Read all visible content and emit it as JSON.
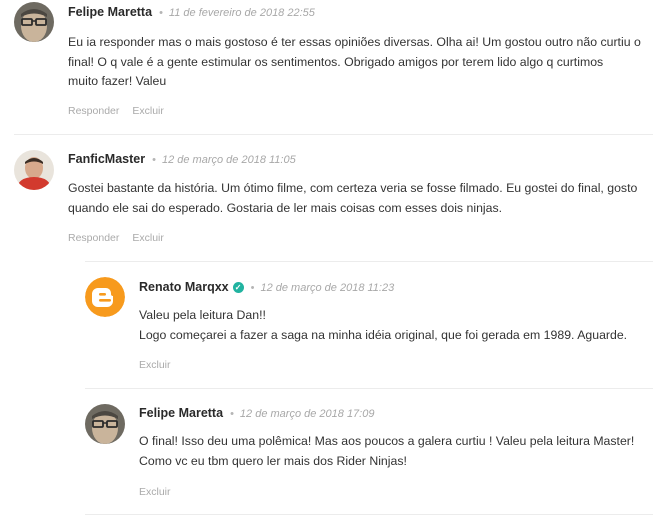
{
  "comments": [
    {
      "author": "Felipe Maretta",
      "date": "11 de fevereiro de 2018 22:55",
      "lines": [
        "Eu ia responder mas o mais gostoso é ter essas opiniões diversas. Olha ai! Um gostou outro não curtiu o",
        "final! O q vale é a gente estimular os sentimentos. Obrigado amigos por terem lido algo q curtimos",
        "muito fazer! Valeu"
      ],
      "reply_label": "Responder",
      "delete_label": "Excluir"
    },
    {
      "author": "FanficMaster",
      "date": "12 de março de 2018 11:05",
      "lines": [
        "Gostei bastante da história. Um ótimo filme, com certeza veria se fosse filmado. Eu gostei do final, gosto",
        "quando ele sai do esperado. Gostaria de ler mais coisas com esses dois ninjas."
      ],
      "reply_label": "Responder",
      "delete_label": "Excluir"
    },
    {
      "author": "Renato Marqxx",
      "verified": true,
      "date": "12 de março de 2018 11:23",
      "lines": [
        "Valeu pela leitura Dan!!",
        "Logo começarei a fazer a saga na minha idéia original, que foi gerada em 1989. Aguarde."
      ],
      "delete_label": "Excluir"
    },
    {
      "author": "Felipe Maretta",
      "date": "12 de março de 2018 17:09",
      "lines": [
        "O final! Isso deu uma polêmica! Mas aos poucos a galera curtiu ! Valeu pela leitura Master!",
        "Como vc eu tbm quero ler mais dos Rider Ninjas!"
      ],
      "delete_label": "Excluir"
    }
  ],
  "avatar_icons": [
    "user-photo-icon",
    "user-photo-icon",
    "blogger-icon",
    "user-photo-icon"
  ],
  "colors": {
    "verified": "#21b3a0",
    "blogger": "#f79a1d",
    "muted_text": "#aaaaaa",
    "divider": "#ececec"
  }
}
